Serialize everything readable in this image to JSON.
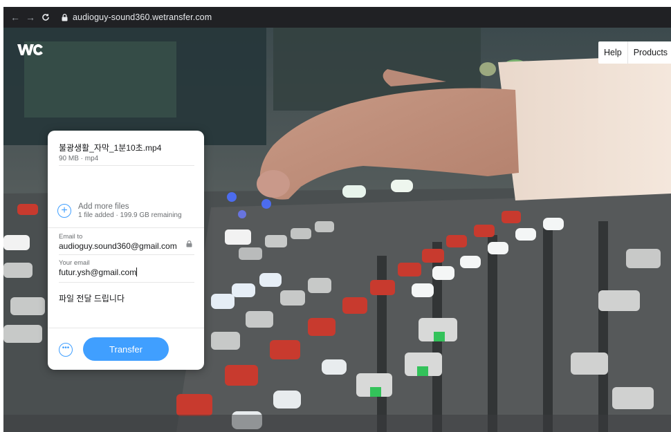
{
  "browser": {
    "url": "audioguy-sound360.wetransfer.com"
  },
  "brand": {
    "logo_icon": "wetransfer-logo-icon"
  },
  "nav": {
    "help": "Help",
    "products": "Products"
  },
  "transfer": {
    "file": {
      "name": "불광생활_자막_1분10초.mp4",
      "meta": "90 MB · mp4"
    },
    "add_more": {
      "label": "Add more files",
      "status": "1 file added · 199.9 GB remaining"
    },
    "email_to": {
      "label": "Email to",
      "value": "audioguy.sound360@gmail.com"
    },
    "your_email": {
      "label": "Your email",
      "value": "futur.ysh@gmail.com"
    },
    "message": "파일 전달 드립니다",
    "transfer_label": "Transfer"
  },
  "colors": {
    "accent": "#409fff",
    "browser_bar": "#202124"
  }
}
